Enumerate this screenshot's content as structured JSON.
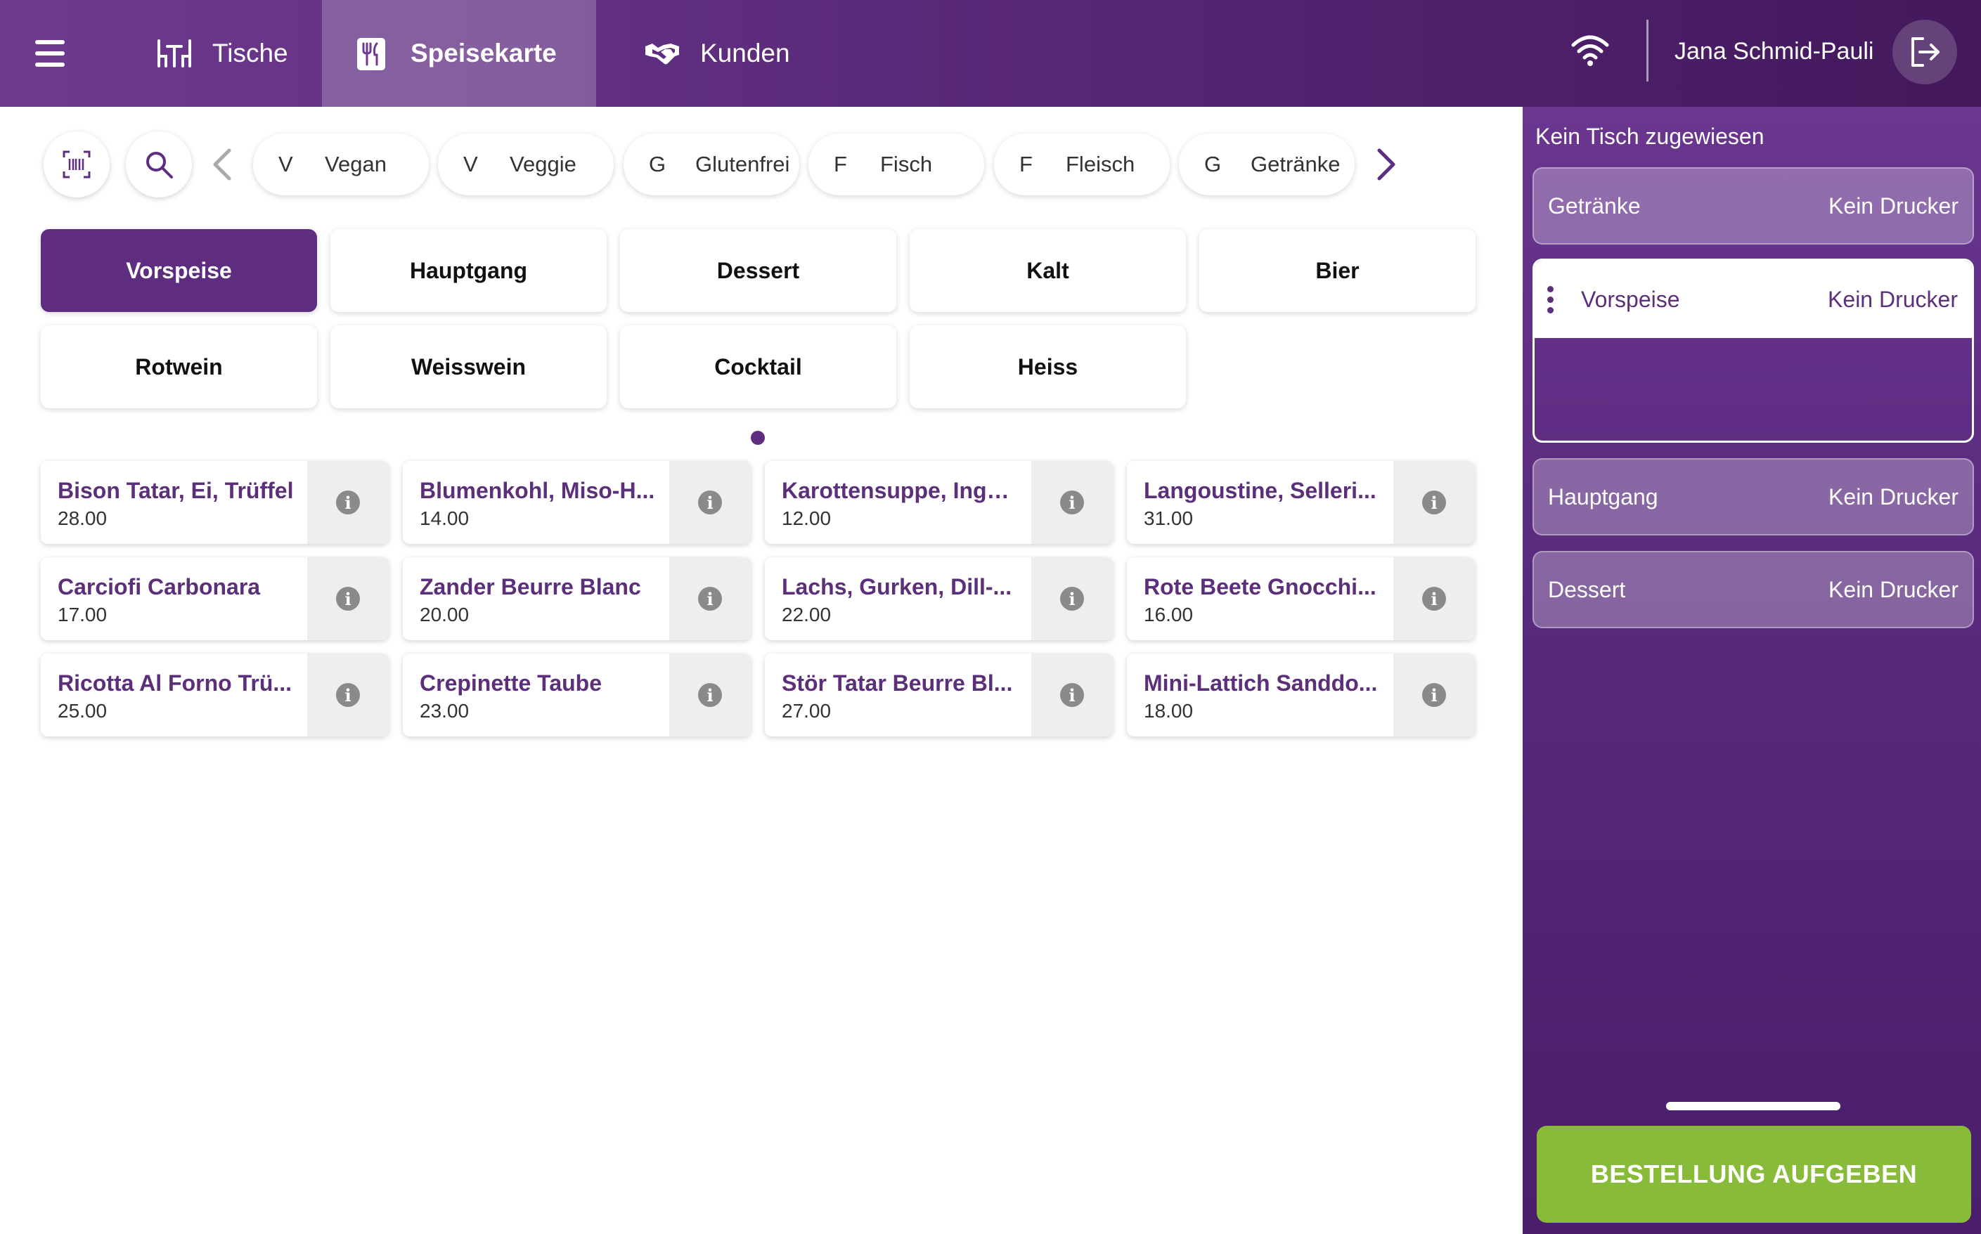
{
  "nav": {
    "tabs": [
      {
        "label": "Tische",
        "icon": "table-chairs-icon"
      },
      {
        "label": "Speisekarte",
        "icon": "menu-fork-icon"
      },
      {
        "label": "Kunden",
        "icon": "handshake-icon"
      }
    ],
    "user_name": "Jana Schmid-Pauli"
  },
  "filters": [
    {
      "letter": "V",
      "label": "Vegan"
    },
    {
      "letter": "V",
      "label": "Veggie"
    },
    {
      "letter": "G",
      "label": "Glutenfrei"
    },
    {
      "letter": "F",
      "label": "Fisch"
    },
    {
      "letter": "F",
      "label": "Fleisch"
    },
    {
      "letter": "G",
      "label": "Getränke"
    }
  ],
  "categories": [
    "Vorspeise",
    "Hauptgang",
    "Dessert",
    "Kalt",
    "Bier",
    "Rotwein",
    "Weisswein",
    "Cocktail",
    "Heiss"
  ],
  "active_category": "Vorspeise",
  "products": [
    {
      "name": "Bison Tatar, Ei, Trüffel",
      "price": "28.00"
    },
    {
      "name": "Blumenkohl, Miso-H...",
      "price": "14.00"
    },
    {
      "name": "Karottensuppe, Ingw...",
      "price": "12.00"
    },
    {
      "name": "Langoustine, Selleri...",
      "price": "31.00"
    },
    {
      "name": "Carciofi Carbonara",
      "price": "17.00"
    },
    {
      "name": "Zander Beurre Blanc",
      "price": "20.00"
    },
    {
      "name": "Lachs, Gurken, Dill-...",
      "price": "22.00"
    },
    {
      "name": "Rote Beete Gnocchi...",
      "price": "16.00"
    },
    {
      "name": "Ricotta Al Forno Trü...",
      "price": "25.00"
    },
    {
      "name": "Crepinette Taube",
      "price": "23.00"
    },
    {
      "name": "Stör Tatar Beurre Bl...",
      "price": "27.00"
    },
    {
      "name": "Mini-Lattich Sanddo...",
      "price": "18.00"
    }
  ],
  "order_panel": {
    "table_status": "Kein Tisch zugewiesen",
    "courses": [
      {
        "name": "Getränke",
        "printer": "Kein Drucker"
      },
      {
        "name": "Vorspeise",
        "printer": "Kein Drucker"
      },
      {
        "name": "Hauptgang",
        "printer": "Kein Drucker"
      },
      {
        "name": "Dessert",
        "printer": "Kein Drucker"
      }
    ],
    "submit_label": "BESTELLUNG AUFGEBEN"
  },
  "colors": {
    "brand_purple": "#5e2d80",
    "submit_green": "#88bb3a"
  }
}
